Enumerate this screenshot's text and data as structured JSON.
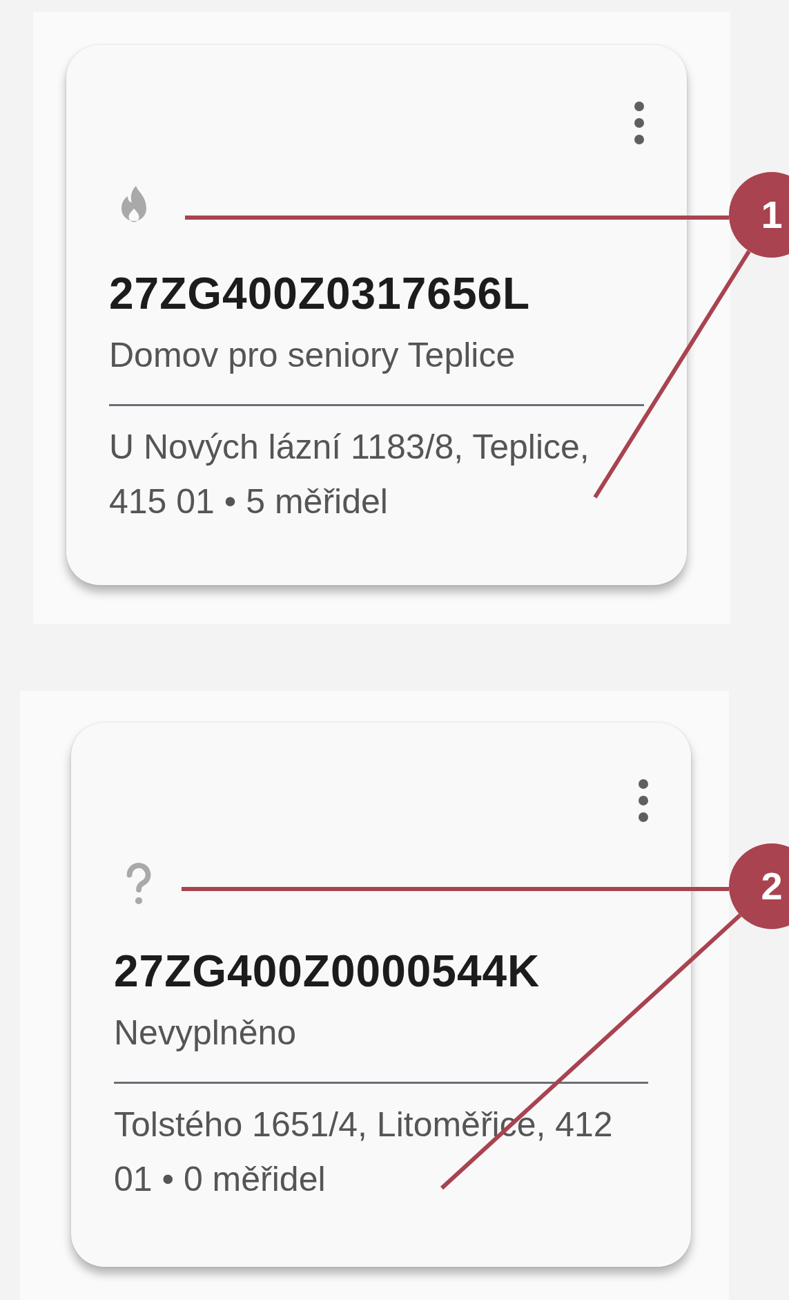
{
  "cards": [
    {
      "kind": "flame",
      "code": "27ZG400Z0317656L",
      "name": "Domov pro seniory Teplice",
      "address": "U Nových lázní 1183/8, Teplice, 415 01 • 5 měřidel"
    },
    {
      "kind": "question",
      "code": "27ZG400Z0000544K",
      "name": "Nevyplněno",
      "address": "Tolstého 1651/4, Litoměřice, 412 01 • 0 měřidel"
    }
  ],
  "callouts": [
    {
      "label": "1"
    },
    {
      "label": "2"
    }
  ]
}
